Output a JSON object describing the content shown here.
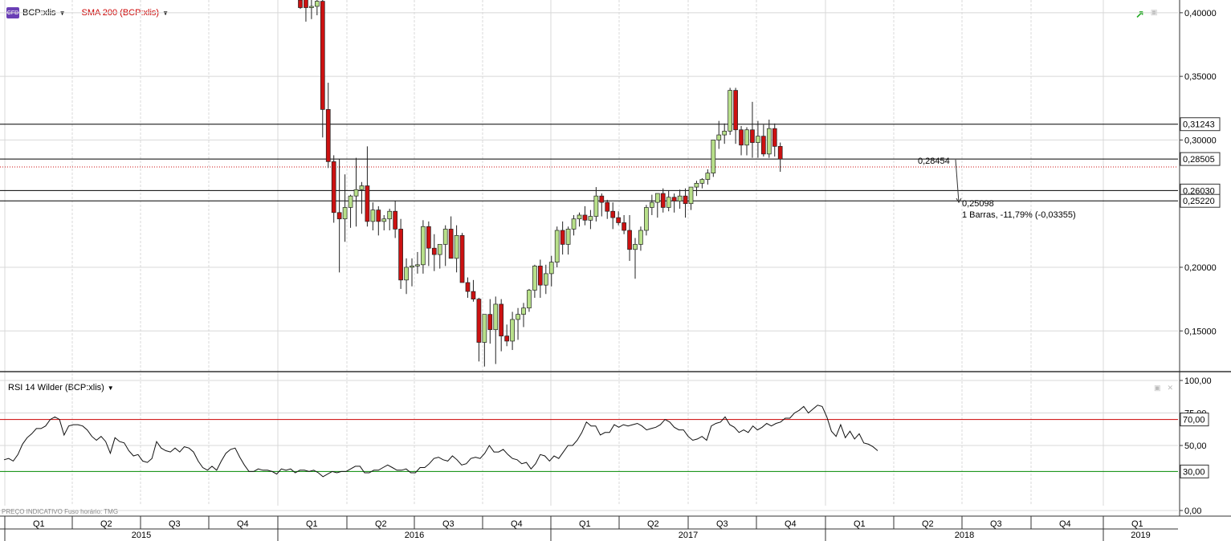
{
  "header": {
    "symbol_icon": "CFD",
    "symbol": "BCP:xlis",
    "indicator": "SMA 200 (BCP:xlis)",
    "indicator_color": "#cc0000",
    "trend_icon": "trend-up-icon"
  },
  "rsi_panel": {
    "title": "RSI 14 Wilder (BCP:xlis)",
    "footer": "PREÇO INDICATIVO   Fuso horário: TMG"
  },
  "price_axis": {
    "ticks": [
      "0,40000",
      "0,35000",
      "0,30000",
      "0,20000",
      "0,15000"
    ],
    "labels": [
      "0,31243",
      "0,28505",
      "0,26030",
      "0,25220"
    ]
  },
  "rsi_axis": {
    "ticks": [
      "100,00",
      "75,00",
      "50,00",
      "0,00"
    ],
    "labels": [
      "70,00",
      "30,00"
    ]
  },
  "measure": {
    "start_label": "0,28454",
    "end_label": "0,25098",
    "summary": "1 Barras, -11,79% (-0,03355)"
  },
  "time_axis": {
    "quarters": [
      "Q1",
      "Q2",
      "Q3",
      "Q4",
      "Q1",
      "Q2",
      "Q3",
      "Q4",
      "Q1",
      "Q2",
      "Q3",
      "Q4",
      "Q1",
      "Q2",
      "Q3",
      "Q4",
      "Q1"
    ],
    "years": [
      "2015",
      "2016",
      "2017",
      "2018",
      "2019"
    ]
  },
  "colors": {
    "up": "#b8e08a",
    "down": "#cc1111",
    "grid": "#d8d8d8",
    "hline": "#000000",
    "overbought": "#cc0000",
    "oversold": "#008800"
  },
  "chart_data": [
    {
      "type": "candlestick",
      "title": "BCP:xlis",
      "series_name": "SMA 200 (BCP:xlis)",
      "ylim": [
        0.118,
        0.41
      ],
      "y_scale": "linear",
      "horizontal_levels": [
        0.31243,
        0.28505,
        0.2603,
        0.2522
      ],
      "sma200_value": 0.2788,
      "measure": {
        "from": 0.28454,
        "to": 0.25098,
        "bars": 1,
        "pct_change": -11.79,
        "abs_change": -0.03355
      },
      "candles": [
        [
          0.41,
          0.413,
          0.403,
          0.404
        ],
        [
          0.413,
          0.414,
          0.393,
          0.404
        ],
        [
          0.404,
          0.41,
          0.395,
          0.405
        ],
        [
          0.405,
          0.41,
          0.398,
          0.409
        ],
        [
          0.409,
          0.412,
          0.302,
          0.324
        ],
        [
          0.324,
          0.345,
          0.278,
          0.283
        ],
        [
          0.283,
          0.288,
          0.235,
          0.243
        ],
        [
          0.243,
          0.285,
          0.196,
          0.238
        ],
        [
          0.238,
          0.273,
          0.22,
          0.247
        ],
        [
          0.247,
          0.257,
          0.231,
          0.256
        ],
        [
          0.256,
          0.286,
          0.232,
          0.261
        ],
        [
          0.261,
          0.267,
          0.242,
          0.264
        ],
        [
          0.264,
          0.295,
          0.232,
          0.236
        ],
        [
          0.236,
          0.251,
          0.229,
          0.245
        ],
        [
          0.245,
          0.248,
          0.225,
          0.236
        ],
        [
          0.236,
          0.241,
          0.229,
          0.238
        ],
        [
          0.238,
          0.246,
          0.229,
          0.244
        ],
        [
          0.244,
          0.252,
          0.223,
          0.23
        ],
        [
          0.23,
          0.238,
          0.183,
          0.19
        ],
        [
          0.19,
          0.207,
          0.179,
          0.2
        ],
        [
          0.2,
          0.207,
          0.185,
          0.201
        ],
        [
          0.201,
          0.212,
          0.195,
          0.202
        ],
        [
          0.202,
          0.237,
          0.195,
          0.232
        ],
        [
          0.232,
          0.236,
          0.201,
          0.215
        ],
        [
          0.215,
          0.226,
          0.197,
          0.21
        ],
        [
          0.21,
          0.218,
          0.199,
          0.218
        ],
        [
          0.218,
          0.233,
          0.201,
          0.23
        ],
        [
          0.23,
          0.24,
          0.21,
          0.207
        ],
        [
          0.207,
          0.233,
          0.196,
          0.225
        ],
        [
          0.225,
          0.227,
          0.196,
          0.188
        ],
        [
          0.188,
          0.192,
          0.176,
          0.181
        ],
        [
          0.181,
          0.19,
          0.173,
          0.175
        ],
        [
          0.175,
          0.176,
          0.126,
          0.141
        ],
        [
          0.141,
          0.161,
          0.122,
          0.163
        ],
        [
          0.163,
          0.175,
          0.14,
          0.151
        ],
        [
          0.151,
          0.177,
          0.124,
          0.171
        ],
        [
          0.171,
          0.175,
          0.134,
          0.146
        ],
        [
          0.146,
          0.155,
          0.138,
          0.142
        ],
        [
          0.142,
          0.165,
          0.135,
          0.159
        ],
        [
          0.159,
          0.168,
          0.143,
          0.163
        ],
        [
          0.163,
          0.172,
          0.153,
          0.168
        ],
        [
          0.168,
          0.183,
          0.165,
          0.182
        ],
        [
          0.182,
          0.202,
          0.176,
          0.201
        ],
        [
          0.201,
          0.206,
          0.176,
          0.186
        ],
        [
          0.186,
          0.202,
          0.179,
          0.195
        ],
        [
          0.195,
          0.209,
          0.185,
          0.204
        ],
        [
          0.204,
          0.232,
          0.2,
          0.229
        ],
        [
          0.229,
          0.236,
          0.21,
          0.218
        ],
        [
          0.218,
          0.232,
          0.21,
          0.23
        ],
        [
          0.23,
          0.241,
          0.225,
          0.238
        ],
        [
          0.238,
          0.243,
          0.232,
          0.241
        ],
        [
          0.241,
          0.248,
          0.233,
          0.237
        ],
        [
          0.237,
          0.245,
          0.23,
          0.24
        ],
        [
          0.24,
          0.263,
          0.236,
          0.256
        ],
        [
          0.256,
          0.258,
          0.24,
          0.251
        ],
        [
          0.251,
          0.253,
          0.238,
          0.244
        ],
        [
          0.244,
          0.251,
          0.23,
          0.239
        ],
        [
          0.239,
          0.244,
          0.233,
          0.235
        ],
        [
          0.235,
          0.241,
          0.226,
          0.229
        ],
        [
          0.229,
          0.241,
          0.205,
          0.214
        ],
        [
          0.214,
          0.223,
          0.191,
          0.218
        ],
        [
          0.218,
          0.232,
          0.213,
          0.229
        ],
        [
          0.229,
          0.249,
          0.225,
          0.247
        ],
        [
          0.247,
          0.257,
          0.241,
          0.251
        ],
        [
          0.251,
          0.258,
          0.239,
          0.258
        ],
        [
          0.258,
          0.262,
          0.243,
          0.247
        ],
        [
          0.247,
          0.26,
          0.244,
          0.255
        ],
        [
          0.255,
          0.258,
          0.243,
          0.252
        ],
        [
          0.252,
          0.261,
          0.246,
          0.256
        ],
        [
          0.256,
          0.262,
          0.239,
          0.25
        ],
        [
          0.25,
          0.26,
          0.245,
          0.263
        ],
        [
          0.263,
          0.268,
          0.256,
          0.266
        ],
        [
          0.266,
          0.27,
          0.262,
          0.269
        ],
        [
          0.269,
          0.277,
          0.265,
          0.274
        ],
        [
          0.274,
          0.3,
          0.271,
          0.3
        ],
        [
          0.3,
          0.315,
          0.293,
          0.304
        ],
        [
          0.304,
          0.313,
          0.297,
          0.307
        ],
        [
          0.307,
          0.341,
          0.304,
          0.339
        ],
        [
          0.339,
          0.341,
          0.297,
          0.308
        ],
        [
          0.308,
          0.311,
          0.288,
          0.296
        ],
        [
          0.296,
          0.31,
          0.288,
          0.308
        ],
        [
          0.308,
          0.33,
          0.286,
          0.298
        ],
        [
          0.298,
          0.315,
          0.286,
          0.303
        ],
        [
          0.303,
          0.312,
          0.287,
          0.289
        ],
        [
          0.289,
          0.316,
          0.286,
          0.309
        ],
        [
          0.309,
          0.313,
          0.287,
          0.295
        ],
        [
          0.295,
          0.298,
          0.275,
          0.285
        ]
      ]
    },
    {
      "type": "line",
      "title": "RSI 14 Wilder (BCP:xlis)",
      "ylim": [
        0,
        100
      ],
      "levels": [
        70,
        30
      ],
      "y": [
        39,
        40,
        38,
        43,
        51,
        56,
        59,
        63,
        63,
        65,
        70,
        72,
        70,
        58,
        65,
        66,
        66,
        65,
        62,
        57,
        54,
        57,
        53,
        44,
        56,
        53,
        52,
        46,
        42,
        43,
        38,
        37,
        40,
        53,
        48,
        46,
        45,
        48,
        45,
        49,
        48,
        45,
        38,
        33,
        31,
        34,
        31,
        38,
        44,
        47,
        48,
        41,
        35,
        30,
        30,
        32,
        31,
        31,
        30,
        28,
        32,
        31,
        32,
        29,
        31,
        31,
        30,
        31,
        29,
        26,
        28,
        30,
        29,
        30,
        30,
        32,
        34,
        34,
        29,
        29,
        31,
        31,
        33,
        35,
        33,
        31,
        31,
        32,
        29,
        29,
        33,
        33,
        36,
        40,
        41,
        39,
        38,
        42,
        39,
        35,
        36,
        40,
        41,
        40,
        44,
        50,
        45,
        45,
        47,
        43,
        40,
        39,
        36,
        37,
        32,
        36,
        43,
        42,
        38,
        42,
        40,
        45,
        50,
        50,
        54,
        60,
        68,
        65,
        65,
        58,
        60,
        60,
        66,
        64,
        66,
        65,
        66,
        67,
        65,
        62,
        63,
        64,
        66,
        70,
        68,
        64,
        62,
        62,
        57,
        54,
        55,
        57,
        54,
        65,
        67,
        68,
        72,
        66,
        64,
        60,
        62,
        60,
        65,
        62,
        64,
        67,
        65,
        67,
        68,
        71,
        71,
        75,
        77,
        80,
        75,
        78,
        81,
        80,
        72,
        61,
        57,
        66,
        56,
        61,
        55,
        59,
        52,
        51,
        49,
        46
      ]
    }
  ]
}
